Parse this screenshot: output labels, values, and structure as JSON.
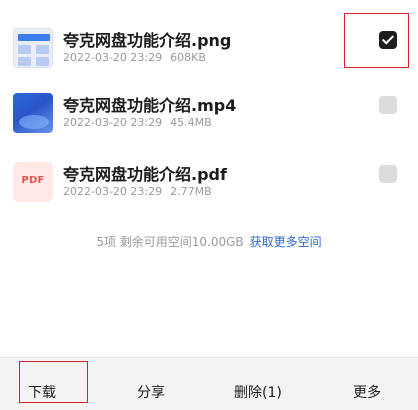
{
  "files": [
    {
      "name": "夸克网盘功能介绍.png",
      "date": "2022-03-20 23:29",
      "size": "608KB",
      "type": "png",
      "checked": true
    },
    {
      "name": "夸克网盘功能介绍.mp4",
      "date": "2022-03-20 23:29",
      "size": "45.4MB",
      "type": "mp4",
      "checked": false
    },
    {
      "name": "夸克网盘功能介绍.pdf",
      "date": "2022-03-20 23:29",
      "size": "2.77MB",
      "type": "pdf",
      "checked": false
    }
  ],
  "pdf_thumb_label": "PDF",
  "storage": {
    "summary": "5项 剩余可用空间10.00GB",
    "link": "获取更多空间"
  },
  "bottom_bar": {
    "download": "下载",
    "share": "分享",
    "delete": "删除(1)",
    "more": "更多"
  },
  "colors": {
    "highlight": "#d9212a",
    "link": "#2f66d6",
    "checkbox_checked": "#1d1d1d",
    "checkbox_unchecked": "#dcdcdc"
  },
  "icons": {
    "png": "image-thumbnail-icon",
    "mp4": "video-thumbnail-icon",
    "pdf": "pdf-file-icon"
  }
}
